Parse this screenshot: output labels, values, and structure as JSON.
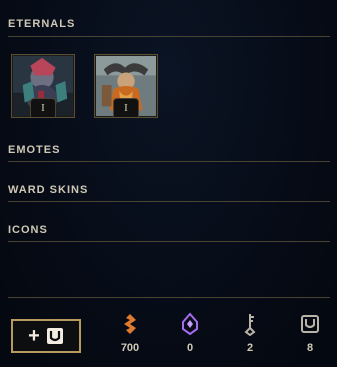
{
  "sections": {
    "eternals": "ETERNALS",
    "emotes": "EMOTES",
    "ward_skins": "WARD SKINS",
    "icons": "ICONS"
  },
  "eternals": [
    {
      "name": "eternal-1",
      "badge": "I"
    },
    {
      "name": "eternal-2",
      "badge": "I"
    }
  ],
  "add_button": {
    "plus": "+"
  },
  "currencies": [
    {
      "icon": "orange-essence-icon",
      "value": "700",
      "color": "#e07a2e"
    },
    {
      "icon": "mythic-essence-icon",
      "value": "0",
      "color": "#a46cf0"
    },
    {
      "icon": "key-icon",
      "value": "2",
      "color": "#b9b4a7"
    },
    {
      "icon": "chest-icon",
      "value": "8",
      "color": "#b9b4a7"
    }
  ]
}
